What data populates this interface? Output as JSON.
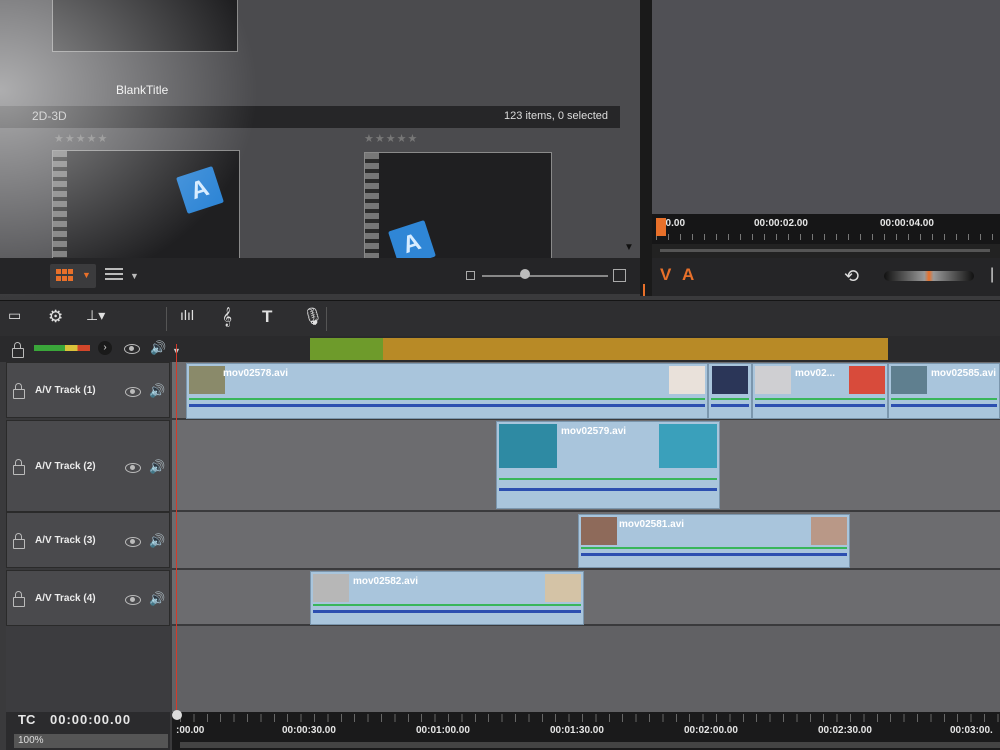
{
  "library": {
    "top_item_title": "BlankTitle",
    "category": "2D-3D",
    "item_count": "123 items, 0 selected",
    "thumb_letter": "A",
    "rating_stars": "★★★★★"
  },
  "player": {
    "ruler": [
      "00.00",
      "00:00:02.00",
      "00:00:04.00"
    ],
    "video_label": "V",
    "audio_label": "A"
  },
  "tracks": [
    {
      "name": "A/V Track (1)",
      "clips": [
        "mov02578.avi",
        "mov02...",
        "mov02585.avi"
      ]
    },
    {
      "name": "A/V Track (2)",
      "clips": [
        "mov02579.avi"
      ]
    },
    {
      "name": "A/V Track (3)",
      "clips": [
        "mov02581.avi"
      ]
    },
    {
      "name": "A/V Track (4)",
      "clips": [
        "mov02582.avi"
      ]
    }
  ],
  "timeline": {
    "tc_label": "TC",
    "timecode": "00:00:00.00",
    "zoom": "100%",
    "ruler": [
      ":00.00",
      "00:00:30.00",
      "00:01:00.00",
      "00:01:30.00",
      "00:02:00.00",
      "00:02:30.00",
      "00:03:00."
    ]
  },
  "icons": {
    "loop": "loop-icon",
    "speaker": "speaker-icon",
    "eye": "eye-icon",
    "lock": "lock-icon"
  },
  "colors": {
    "accent": "#e8702a",
    "clip": "#a9c5dc",
    "playhead": "#d23a2a"
  }
}
